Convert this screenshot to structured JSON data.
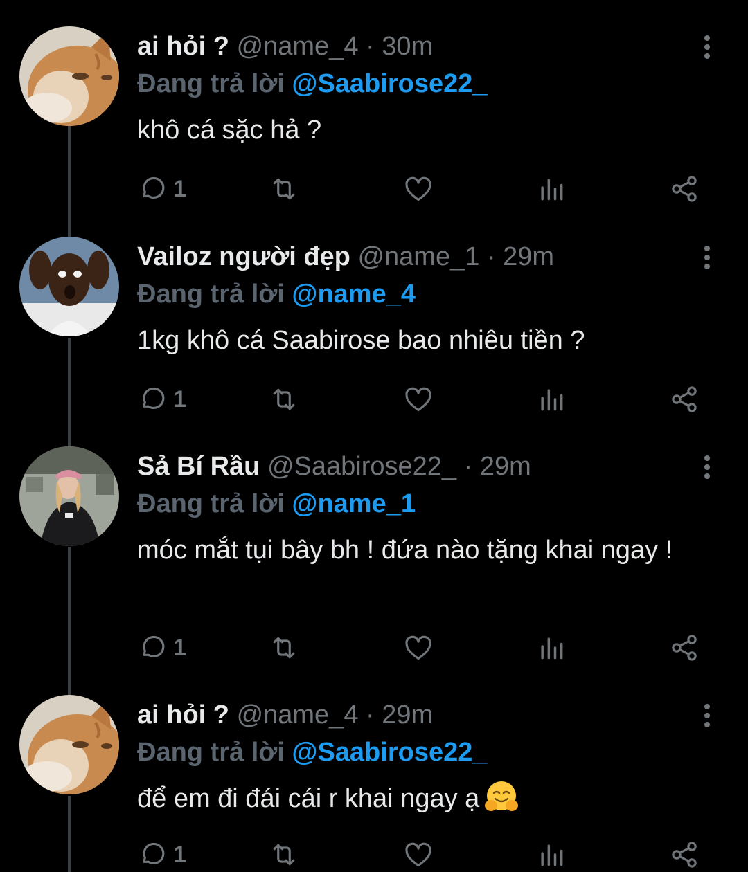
{
  "tweets": [
    {
      "name": "ai hỏi ?",
      "handle": "@name_4",
      "sep": "·",
      "time": "30m",
      "reply_prefix": "Đang trả lời",
      "reply_to": "@Saabirose22_",
      "text": "khô cá sặc hả ?",
      "reply_count": "1",
      "avatar_icon": "orange-cat-avatar"
    },
    {
      "name": "Vailoz người đẹp",
      "handle": "@name_1",
      "sep": "·",
      "time": "29m",
      "reply_prefix": "Đang trả lời",
      "reply_to": "@name_4",
      "text": "1kg khô cá Saabirose bao nhiêu tiền ?",
      "reply_count": "1",
      "avatar_icon": "surprised-man-avatar"
    },
    {
      "name": "Sả Bí Rầu",
      "handle": "@Saabirose22_",
      "sep": "·",
      "time": "29m",
      "reply_prefix": "Đang trả lời",
      "reply_to": "@name_1",
      "text": "móc mắt tụi bây bh ! đứa nào tặng khai ngay !",
      "reply_count": "1",
      "avatar_icon": "girl-street-avatar"
    },
    {
      "name": "ai hỏi ?",
      "handle": "@name_4",
      "sep": "·",
      "time": "29m",
      "reply_prefix": "Đang trả lời",
      "reply_to": "@Saabirose22_",
      "text": "để em đi đái cái r khai ngay ạ",
      "emoji": "hugging-face-emoji",
      "reply_count": "1",
      "avatar_icon": "orange-cat-avatar"
    }
  ],
  "colors": {
    "background": "#000000",
    "text": "#e7e9ea",
    "secondary": "#71767b",
    "mention": "#1d9bf0",
    "thread_line": "#3a3f44"
  }
}
